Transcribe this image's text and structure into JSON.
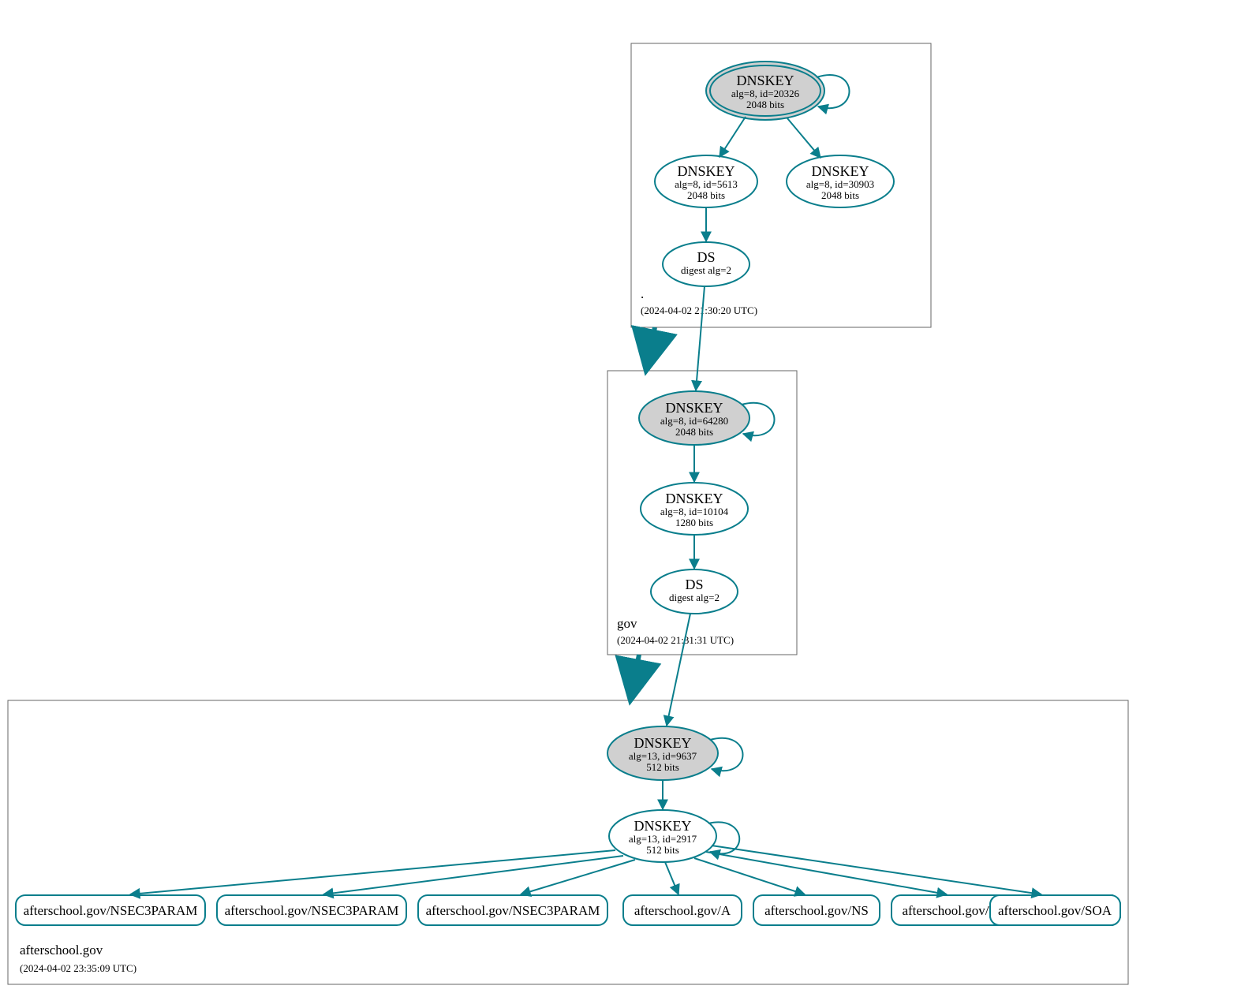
{
  "colors": {
    "stroke": "#0a7e8c",
    "ksk_fill": "#d0d0d0",
    "white": "#ffffff",
    "box": "#666666"
  },
  "zones": {
    "root": {
      "label": ".",
      "timestamp": "(2024-04-02 21:30:20 UTC)"
    },
    "gov": {
      "label": "gov",
      "timestamp": "(2024-04-02 21:31:31 UTC)"
    },
    "afterschool": {
      "label": "afterschool.gov",
      "timestamp": "(2024-04-02 23:35:09 UTC)"
    }
  },
  "nodes": {
    "root_ksk": {
      "title": "DNSKEY",
      "line2": "alg=8, id=20326",
      "line3": "2048 bits"
    },
    "root_zsk": {
      "title": "DNSKEY",
      "line2": "alg=8, id=5613",
      "line3": "2048 bits"
    },
    "root_extra": {
      "title": "DNSKEY",
      "line2": "alg=8, id=30903",
      "line3": "2048 bits"
    },
    "root_ds": {
      "title": "DS",
      "line2": "digest alg=2"
    },
    "gov_ksk": {
      "title": "DNSKEY",
      "line2": "alg=8, id=64280",
      "line3": "2048 bits"
    },
    "gov_zsk": {
      "title": "DNSKEY",
      "line2": "alg=8, id=10104",
      "line3": "1280 bits"
    },
    "gov_ds": {
      "title": "DS",
      "line2": "digest alg=2"
    },
    "as_ksk": {
      "title": "DNSKEY",
      "line2": "alg=13, id=9637",
      "line3": "512 bits"
    },
    "as_zsk": {
      "title": "DNSKEY",
      "line2": "alg=13, id=2917",
      "line3": "512 bits"
    }
  },
  "rrsets": {
    "r1": "afterschool.gov/NSEC3PARAM",
    "r2": "afterschool.gov/NSEC3PARAM",
    "r3": "afterschool.gov/NSEC3PARAM",
    "r4": "afterschool.gov/A",
    "r5": "afterschool.gov/NS",
    "r6": "afterschool.gov/TXT",
    "r7": "afterschool.gov/SOA"
  }
}
